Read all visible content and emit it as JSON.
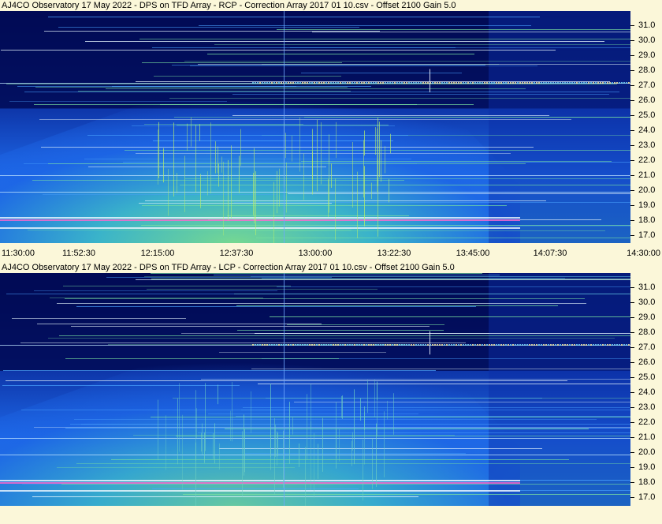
{
  "panels": [
    {
      "title": "AJ4CO Observatory 17 May 2022  -  DPS on TFD Array  -  RCP  -  Correction Array 2017 01 10.csv  -  Offset 2100  Gain 5.0",
      "y_labels": [
        "31.0",
        "30.0",
        "29.0",
        "28.0",
        "27.0",
        "26.0",
        "25.0",
        "24.0",
        "23.0",
        "22.0",
        "21.0",
        "20.0",
        "19.0",
        "18.0",
        "17.0"
      ],
      "x_labels": [
        "11:30:00",
        "11:52:30",
        "12:15:00",
        "12:37:30",
        "13:00:00",
        "13:22:30",
        "13:45:00",
        "14:07:30",
        "14:30:00"
      ]
    },
    {
      "title": "AJ4CO Observatory 17 May 2022  -  DPS on TFD Array  -  LCP  -  Correction Array 2017 01 10.csv  -  Offset 2100  Gain 5.0",
      "y_labels": [
        "31.0",
        "30.0",
        "29.0",
        "28.0",
        "27.0",
        "26.0",
        "25.0",
        "24.0",
        "23.0",
        "22.0",
        "21.0",
        "20.0",
        "19.0",
        "18.0",
        "17.0"
      ]
    }
  ],
  "colors": {
    "background": "#fbf7d9",
    "spectrogram_dark": "#010b55",
    "spectrogram_mid": "#1d66e6",
    "spectrogram_bright": "#7ee08a"
  }
}
